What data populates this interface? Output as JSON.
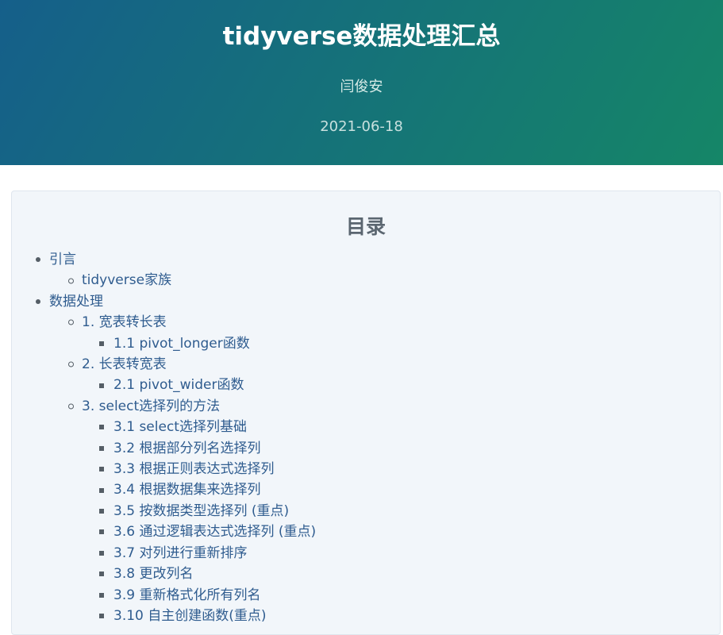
{
  "header": {
    "title": "tidyverse数据处理汇总",
    "author": "闫俊安",
    "date": "2021-06-18"
  },
  "toc": {
    "title": "目录",
    "items": [
      {
        "level": 1,
        "label": "引言"
      },
      {
        "level": 2,
        "label": "tidyverse家族"
      },
      {
        "level": 1,
        "label": "数据处理"
      },
      {
        "level": 2,
        "label": "1. 宽表转长表"
      },
      {
        "level": 3,
        "label": "1.1 pivot_longer函数"
      },
      {
        "level": 2,
        "label": "2. 长表转宽表"
      },
      {
        "level": 3,
        "label": "2.1 pivot_wider函数"
      },
      {
        "level": 2,
        "label": "3. select选择列的方法"
      },
      {
        "level": 3,
        "label": "3.1 select选择列基础"
      },
      {
        "level": 3,
        "label": "3.2 根据部分列名选择列"
      },
      {
        "level": 3,
        "label": "3.3 根据正则表达式选择列"
      },
      {
        "level": 3,
        "label": "3.4 根据数据集来选择列"
      },
      {
        "level": 3,
        "label": "3.5 按数据类型选择列 (重点)"
      },
      {
        "level": 3,
        "label": "3.6 通过逻辑表达式选择列 (重点)"
      },
      {
        "level": 3,
        "label": "3.7 对列进行重新排序"
      },
      {
        "level": 3,
        "label": "3.8 更改列名"
      },
      {
        "level": 3,
        "label": "3.9 重新格式化所有列名"
      },
      {
        "level": 3,
        "label": "3.10 自主创建函数(重点)"
      }
    ]
  }
}
